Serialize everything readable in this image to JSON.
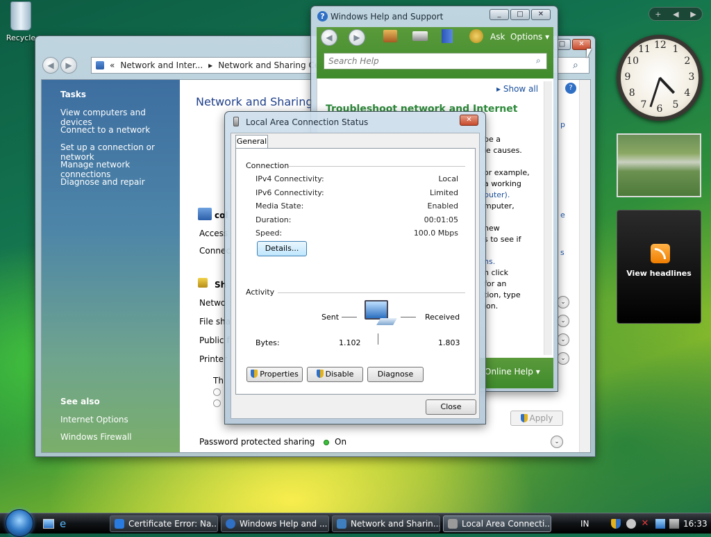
{
  "desktop": {
    "recycle_bin_label": "Recycle",
    "news_gadget_label": "View headlines"
  },
  "nsc_window": {
    "breadcrumb": [
      "«",
      "Network and Inter...",
      "▸",
      "Network and Sharing Ce..."
    ],
    "tasks_header": "Tasks",
    "tasks": [
      "View computers and devices",
      "Connect to a network",
      "Set up a connection or network",
      "Manage network connections",
      "Diagnose and repair"
    ],
    "see_also_header": "See also",
    "see_also": [
      "Internet Options",
      "Windows Firewall"
    ],
    "title": "Network and Sharing Ce",
    "network_name": "col",
    "rows": [
      "Access",
      "Connec"
    ],
    "sharing_header": "Sh",
    "sharing_rows": [
      "Netwo",
      "File sha",
      "Public f",
      "Printer"
    ],
    "the_text": "Th",
    "apply_label": "Apply",
    "password_label": "Password protected sharing",
    "password_value": "On"
  },
  "help_window": {
    "title": "Windows Help and Support",
    "ask_label": "Ask",
    "options_label": "Options",
    "search_placeholder": "Search Help",
    "show_all": "Show all",
    "heading": "Troubleshoot network and Internet",
    "text_lines": [
      "be a",
      "le causes.",
      "",
      "or example,",
      "a working",
      "puter).",
      "mputer,",
      "",
      "new",
      "s to see if",
      "",
      "ns.",
      "n click",
      "for an",
      "tion, type",
      "ion."
    ],
    "side_p": "p",
    "side_e": "e",
    "side_s": "s",
    "footer_label": "Online Help"
  },
  "lac_dialog": {
    "title": "Local Area Connection Status",
    "tab_general": "General",
    "connection_header": "Connection",
    "connection_rows": [
      {
        "key": "IPv4 Connectivity:",
        "value": "Local"
      },
      {
        "key": "IPv6 Connectivity:",
        "value": "Limited"
      },
      {
        "key": "Media State:",
        "value": "Enabled"
      },
      {
        "key": "Duration:",
        "value": "00:01:05"
      },
      {
        "key": "Speed:",
        "value": "100.0 Mbps"
      }
    ],
    "details_label": "Details...",
    "activity_header": "Activity",
    "sent_label": "Sent",
    "received_label": "Received",
    "bytes_label": "Bytes:",
    "bytes_sent": "1.102",
    "bytes_received": "1.803",
    "properties_label": "Properties",
    "disable_label": "Disable",
    "diagnose_label": "Diagnose",
    "close_label": "Close"
  },
  "taskbar": {
    "tasks": [
      {
        "label": "Certificate Error: Na...",
        "icon_color": "#2a7be0"
      },
      {
        "label": "Windows Help and ...",
        "icon_color": "#2f6fc4"
      },
      {
        "label": "Network and Sharin...",
        "icon_color": "#3f7fbf"
      },
      {
        "label": "Local Area Connecti...",
        "icon_color": "#9a9a9a"
      }
    ],
    "language": "IN",
    "time": "16:33"
  },
  "clock": {
    "numbers": [
      "12",
      "1",
      "2",
      "3",
      "4",
      "5",
      "6",
      "7",
      "8",
      "9",
      "10",
      "11"
    ],
    "hour": 4,
    "minute": 33
  }
}
